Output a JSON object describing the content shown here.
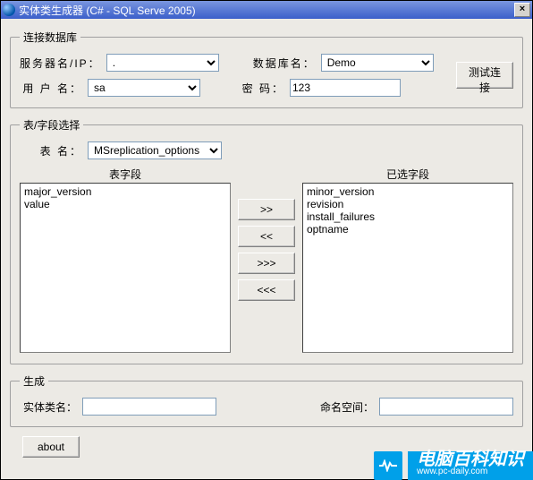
{
  "window": {
    "title": "实体类生成器 (C# - SQL Serve 2005)"
  },
  "conn": {
    "legend": "连接数据库",
    "server_label": "服务器名/IP：",
    "server_value": ".",
    "user_label": "用 户 名：",
    "user_value": "sa",
    "db_label": "数据库名：",
    "db_value": "Demo",
    "pwd_label": "密   码：",
    "pwd_value": "123",
    "test_btn": "测试连接"
  },
  "sel": {
    "legend": "表/字段选择",
    "table_label": "表   名：",
    "table_value": "MSreplication_options",
    "left_header": "表字段",
    "right_header": "已选字段",
    "left_items": [
      "major_version",
      "value"
    ],
    "right_items": [
      "minor_version",
      "revision",
      "install_failures",
      "optname"
    ],
    "btn_add": ">>",
    "btn_remove": "<<",
    "btn_addall": ">>>",
    "btn_removeall": "<<<"
  },
  "gen": {
    "legend": "生成",
    "class_label": "实体类名：",
    "class_value": "",
    "ns_label": "命名空间：",
    "ns_value": ""
  },
  "bottom": {
    "about": "about"
  },
  "watermark": {
    "text": "电脑百科知识",
    "url": "www.pc-daily.com"
  }
}
